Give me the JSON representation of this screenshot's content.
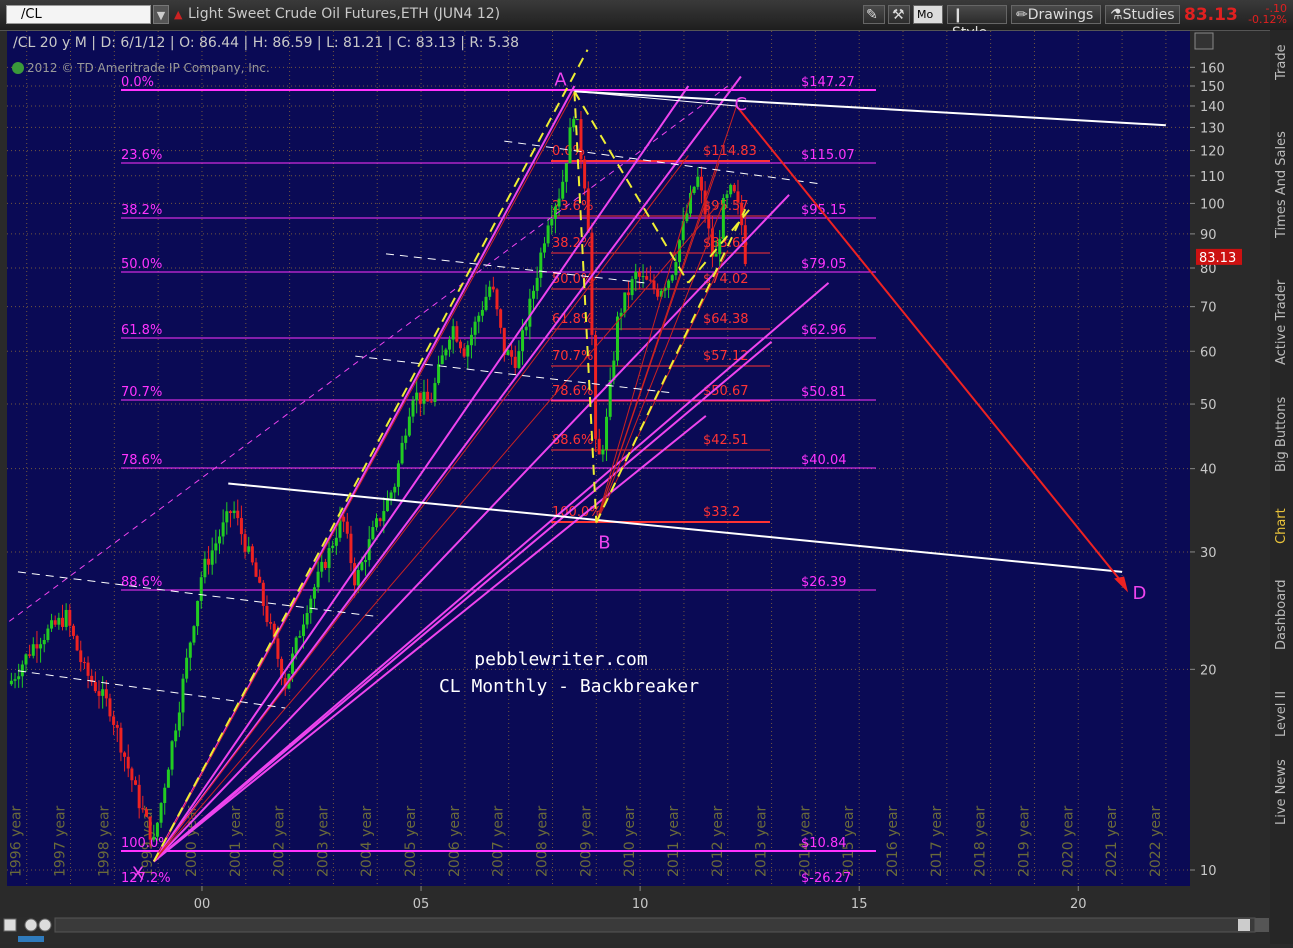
{
  "header": {
    "symbol": "/CL",
    "description": "Light Sweet Crude Oil Futures,ETH (JUN4 12)",
    "mo_label": "Mo",
    "style_label": "Style",
    "drawings_label": "Drawings",
    "studies_label": "Studies",
    "last_price": "83.13",
    "change": "-.10",
    "change_pct": "-0.12%"
  },
  "sidebar": {
    "tabs": [
      {
        "label": "Trade"
      },
      {
        "label": "Times And Sales"
      },
      {
        "label": "Active Trader"
      },
      {
        "label": "Big Buttons"
      },
      {
        "label": "Chart"
      },
      {
        "label": "Dashboard"
      },
      {
        "label": "Level II"
      },
      {
        "label": "Live News"
      }
    ]
  },
  "chart_data": {
    "type": "candlestick",
    "title": "pebblewriter.com",
    "subtitle": "CL Monthly - Backbreaker",
    "info_line": "/CL 20 y M | D: 6/1/12 | O: 86.44 | H: 86.59 | L: 81.21 | C: 83.13 | R: 5.38",
    "copyright": "2012 © TD Ameritrade IP Company, Inc.",
    "last_price_badge": "83.13",
    "y_scale": "log",
    "ylim": [
      9,
      170
    ],
    "y_ticks": [
      10,
      20,
      30,
      40,
      50,
      60,
      70,
      80,
      90,
      100,
      110,
      120,
      130,
      140,
      150,
      160
    ],
    "x_ticks_bottom": [
      "00",
      "05",
      "10",
      "15",
      "20"
    ],
    "x_ticks_bottom_years": [
      2000,
      2005,
      2010,
      2015,
      2020
    ],
    "year_labels": [
      "1996 year",
      "1997 year",
      "1998 year",
      "1999 year",
      "2000 year",
      "2001 year",
      "2002 year",
      "2003 year",
      "2004 year",
      "2005 year",
      "2006 year",
      "2007 year",
      "2008 year",
      "2009 year",
      "2010 year",
      "2011 year",
      "2012 year",
      "2013 year",
      "2014 year",
      "2015 year",
      "2016 year",
      "2017 year",
      "2018 year",
      "2019 year",
      "2020 year",
      "2021 year",
      "2022 year"
    ],
    "points": [
      {
        "name": "X",
        "year": 1998.9,
        "price": 10.3
      },
      {
        "name": "A",
        "year": 2008.5,
        "price": 147.27
      },
      {
        "name": "B",
        "year": 2009.0,
        "price": 33.2
      },
      {
        "name": "C",
        "year": 2012.2,
        "price": 140
      },
      {
        "name": "D",
        "year": 2021.1,
        "price": 26.39
      }
    ],
    "fib_major": [
      {
        "pct": "0.0%",
        "price": 147.27,
        "label": "$147.27"
      },
      {
        "pct": "23.6%",
        "price": 115.07,
        "label": "$115.07"
      },
      {
        "pct": "38.2%",
        "price": 95.15,
        "label": "$95.15"
      },
      {
        "pct": "50.0%",
        "price": 79.05,
        "label": "$79.05"
      },
      {
        "pct": "61.8%",
        "price": 62.96,
        "label": "$62.96"
      },
      {
        "pct": "70.7%",
        "price": 50.81,
        "label": "$50.81"
      },
      {
        "pct": "78.6%",
        "price": 40.04,
        "label": "$40.04"
      },
      {
        "pct": "88.6%",
        "price": 26.39,
        "label": "$26.39"
      },
      {
        "pct": "100.0%",
        "price": 10.84,
        "label": "$10.84"
      },
      {
        "pct": "127.2%",
        "price": 10.84,
        "label": "$-26.27"
      }
    ],
    "fib_minor": [
      {
        "pct": "0.0%",
        "price": 114.83,
        "label": "$114.83"
      },
      {
        "pct": "23.6%",
        "price": 95.57,
        "label": "$95.57"
      },
      {
        "pct": "38.2%",
        "price": 83.65,
        "label": "$83.65"
      },
      {
        "pct": "50.0%",
        "price": 74.02,
        "label": "$74.02"
      },
      {
        "pct": "61.8%",
        "price": 64.38,
        "label": "$64.38"
      },
      {
        "pct": "70.7%",
        "price": 57.12,
        "label": "$57.12"
      },
      {
        "pct": "78.6%",
        "price": 50.67,
        "label": "$50.67"
      },
      {
        "pct": "88.6%",
        "price": 42.51,
        "label": "$42.51"
      },
      {
        "pct": "100.0%",
        "price": 33.2,
        "label": "$33.2"
      }
    ],
    "colors": {
      "background": "#0a0a55",
      "grid": "#8a6a3a",
      "fib_major": "#ff33ff",
      "fib_minor": "#ff3333",
      "pattern": "#ee44ee",
      "xabcd_dash": "#eeee33",
      "up": "#22cc22",
      "down": "#ee2222",
      "axis_text": "#c8c8c8",
      "trend": "#ffffff"
    }
  }
}
